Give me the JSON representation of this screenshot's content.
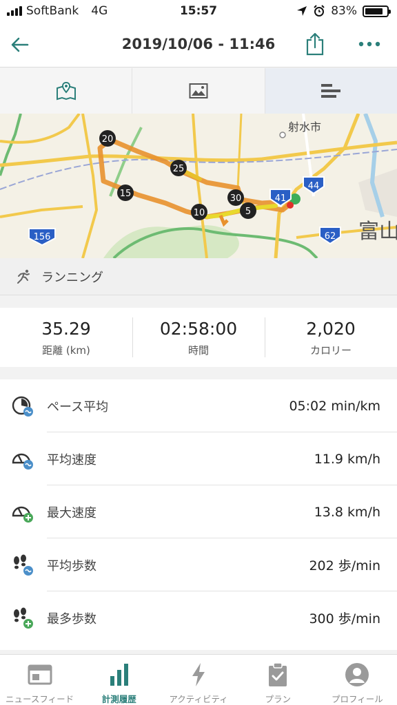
{
  "status_bar": {
    "carrier": "SoftBank",
    "network": "4G",
    "time": "15:57",
    "battery": "83%",
    "battery_level": 0.83
  },
  "header": {
    "title": "2019/10/06 - 11:46"
  },
  "view_tabs": [
    {
      "icon": "map-icon"
    },
    {
      "icon": "photo-icon"
    },
    {
      "icon": "chart-bars-icon",
      "selected": true
    }
  ],
  "map": {
    "city_label": "射水市",
    "city_label_2": "富山",
    "route_shields": [
      "156",
      "41",
      "44",
      "62"
    ],
    "route_markers": [
      "5",
      "10",
      "15",
      "20",
      "25",
      "30"
    ],
    "colors": {
      "route": "#e8912d",
      "route_fast": "#e8d92d",
      "start": "#3fae5a",
      "end": "#e0302a"
    }
  },
  "activity": {
    "label": "ランニング"
  },
  "summary": [
    {
      "value": "35.29",
      "label": "距離 (km)"
    },
    {
      "value": "02:58:00",
      "label": "時間"
    },
    {
      "value": "2,020",
      "label": "カロリー"
    }
  ],
  "stats": [
    {
      "label": "ペース平均",
      "value": "05:02 min/km",
      "icon": "pace-avg-icon"
    },
    {
      "label": "平均速度",
      "value": "11.9 km/h",
      "icon": "speed-avg-icon"
    },
    {
      "label": "最大速度",
      "value": "13.8 km/h",
      "icon": "speed-max-icon"
    },
    {
      "label": "平均歩数",
      "value": "202 歩/min",
      "icon": "steps-avg-icon"
    },
    {
      "label": "最多歩数",
      "value": "300 歩/min",
      "icon": "steps-max-icon"
    }
  ],
  "bottom_nav": [
    {
      "label": "ニュースフィード",
      "icon": "newsfeed-icon"
    },
    {
      "label": "計測履歴",
      "icon": "history-icon",
      "active": true
    },
    {
      "label": "アクティビティ",
      "icon": "activity-icon"
    },
    {
      "label": "プラン",
      "icon": "plan-icon"
    },
    {
      "label": "プロフィール",
      "icon": "profile-icon"
    }
  ],
  "colors": {
    "accent": "#2b7f7a",
    "icon_gray": "#9a9a9a"
  }
}
